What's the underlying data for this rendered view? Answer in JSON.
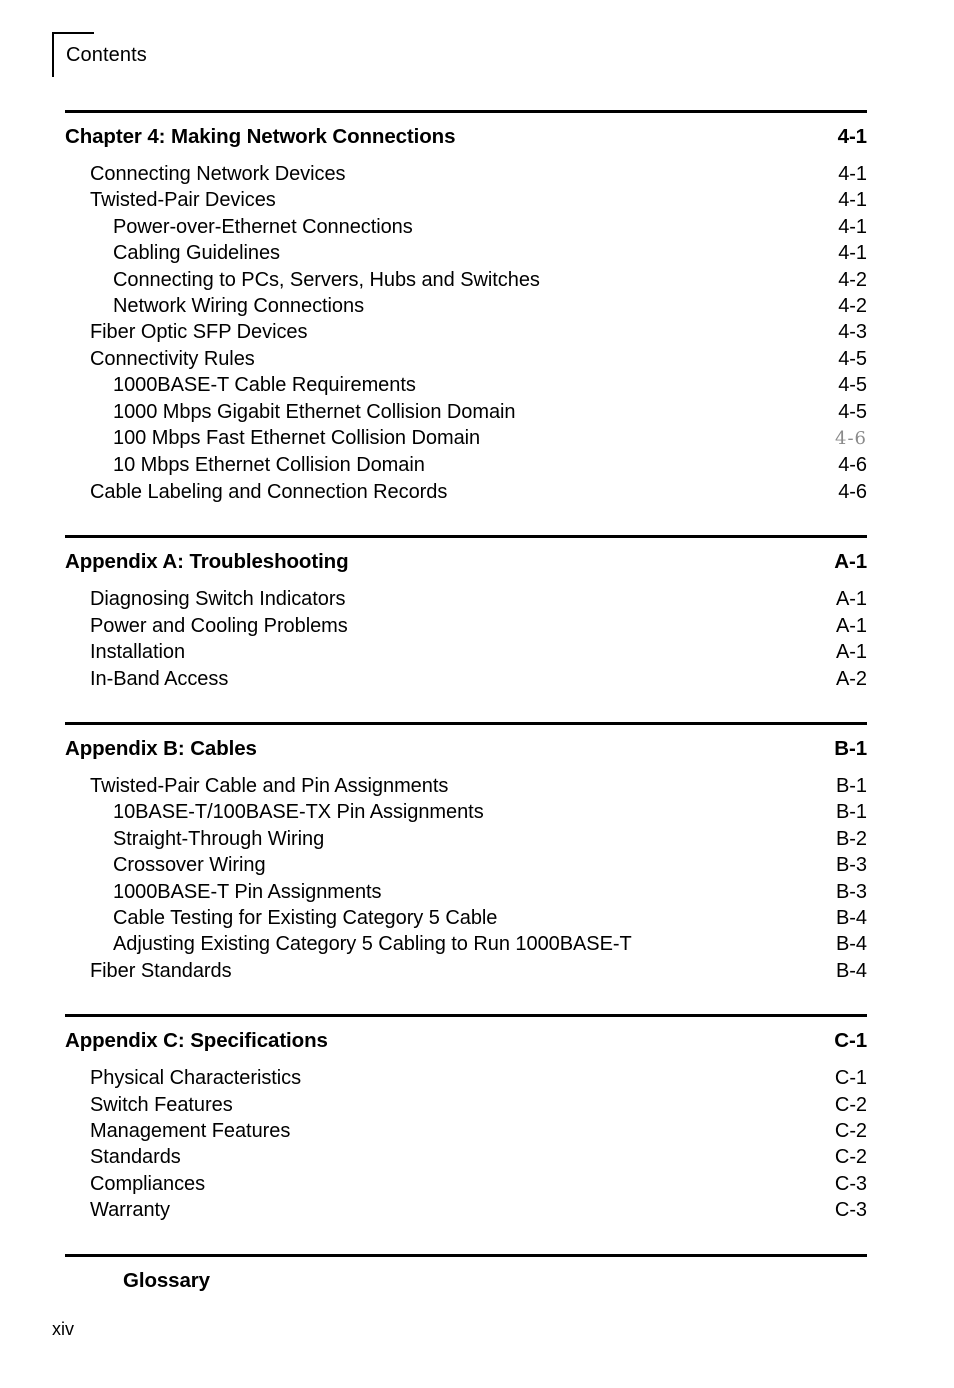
{
  "header": {
    "running_head": "Contents"
  },
  "footer": {
    "page_number": "xiv"
  },
  "glossary": {
    "label": "Glossary"
  },
  "sections": [
    {
      "heading": "Chapter 4: Making Network Connections",
      "heading_page": "4-1",
      "entries": [
        {
          "level": 1,
          "label": "Connecting Network Devices",
          "page": "4-1"
        },
        {
          "level": 1,
          "label": "Twisted-Pair Devices",
          "page": "4-1"
        },
        {
          "level": 2,
          "label": "Power-over-Ethernet Connections",
          "page": "4-1"
        },
        {
          "level": 2,
          "label": "Cabling Guidelines",
          "page": "4-1"
        },
        {
          "level": 2,
          "label": "Connecting to PCs, Servers, Hubs and Switches",
          "page": "4-2"
        },
        {
          "level": 2,
          "label": "Network Wiring Connections",
          "page": "4-2"
        },
        {
          "level": 1,
          "label": "Fiber Optic SFP Devices",
          "page": "4-3"
        },
        {
          "level": 1,
          "label": "Connectivity Rules",
          "page": "4-5"
        },
        {
          "level": 2,
          "label": "1000BASE-T Cable Requirements",
          "page": "4-5"
        },
        {
          "level": 2,
          "label": "1000 Mbps Gigabit Ethernet Collision Domain",
          "page": "4-5"
        },
        {
          "level": 2,
          "label": "100 Mbps Fast Ethernet Collision Domain",
          "page": "4-6",
          "page_style": "alt"
        },
        {
          "level": 2,
          "label": "10 Mbps Ethernet Collision Domain",
          "page": "4-6"
        },
        {
          "level": 1,
          "label": "Cable Labeling and Connection Records",
          "page": "4-6"
        }
      ]
    },
    {
      "heading": "Appendix A: Troubleshooting",
      "heading_page": "A-1",
      "entries": [
        {
          "level": 1,
          "label": "Diagnosing Switch Indicators",
          "page": "A-1"
        },
        {
          "level": 1,
          "label": "Power and Cooling Problems",
          "page": "A-1"
        },
        {
          "level": 1,
          "label": "Installation",
          "page": "A-1"
        },
        {
          "level": 1,
          "label": "In-Band Access",
          "page": "A-2"
        }
      ]
    },
    {
      "heading": "Appendix B: Cables",
      "heading_page": "B-1",
      "entries": [
        {
          "level": 1,
          "label": "Twisted-Pair Cable and Pin Assignments",
          "page": "B-1"
        },
        {
          "level": 2,
          "label": "10BASE-T/100BASE-TX Pin Assignments",
          "page": "B-1"
        },
        {
          "level": 2,
          "label": "Straight-Through Wiring",
          "page": "B-2"
        },
        {
          "level": 2,
          "label": "Crossover Wiring",
          "page": "B-3"
        },
        {
          "level": 2,
          "label": "1000BASE-T Pin Assignments",
          "page": "B-3"
        },
        {
          "level": 2,
          "label": "Cable Testing for Existing Category 5 Cable",
          "page": "B-4"
        },
        {
          "level": 2,
          "label": "Adjusting Existing Category 5 Cabling to Run 1000BASE-T",
          "page": "B-4"
        },
        {
          "level": 1,
          "label": "Fiber Standards",
          "page": "B-4"
        }
      ]
    },
    {
      "heading": "Appendix C: Specifications",
      "heading_page": "C-1",
      "entries": [
        {
          "level": 1,
          "label": "Physical Characteristics",
          "page": "C-1"
        },
        {
          "level": 1,
          "label": "Switch Features",
          "page": "C-2"
        },
        {
          "level": 1,
          "label": "Management Features",
          "page": "C-2"
        },
        {
          "level": 1,
          "label": "Standards",
          "page": "C-2"
        },
        {
          "level": 1,
          "label": "Compliances",
          "page": "C-3"
        },
        {
          "level": 1,
          "label": "Warranty",
          "page": "C-3"
        }
      ]
    }
  ]
}
